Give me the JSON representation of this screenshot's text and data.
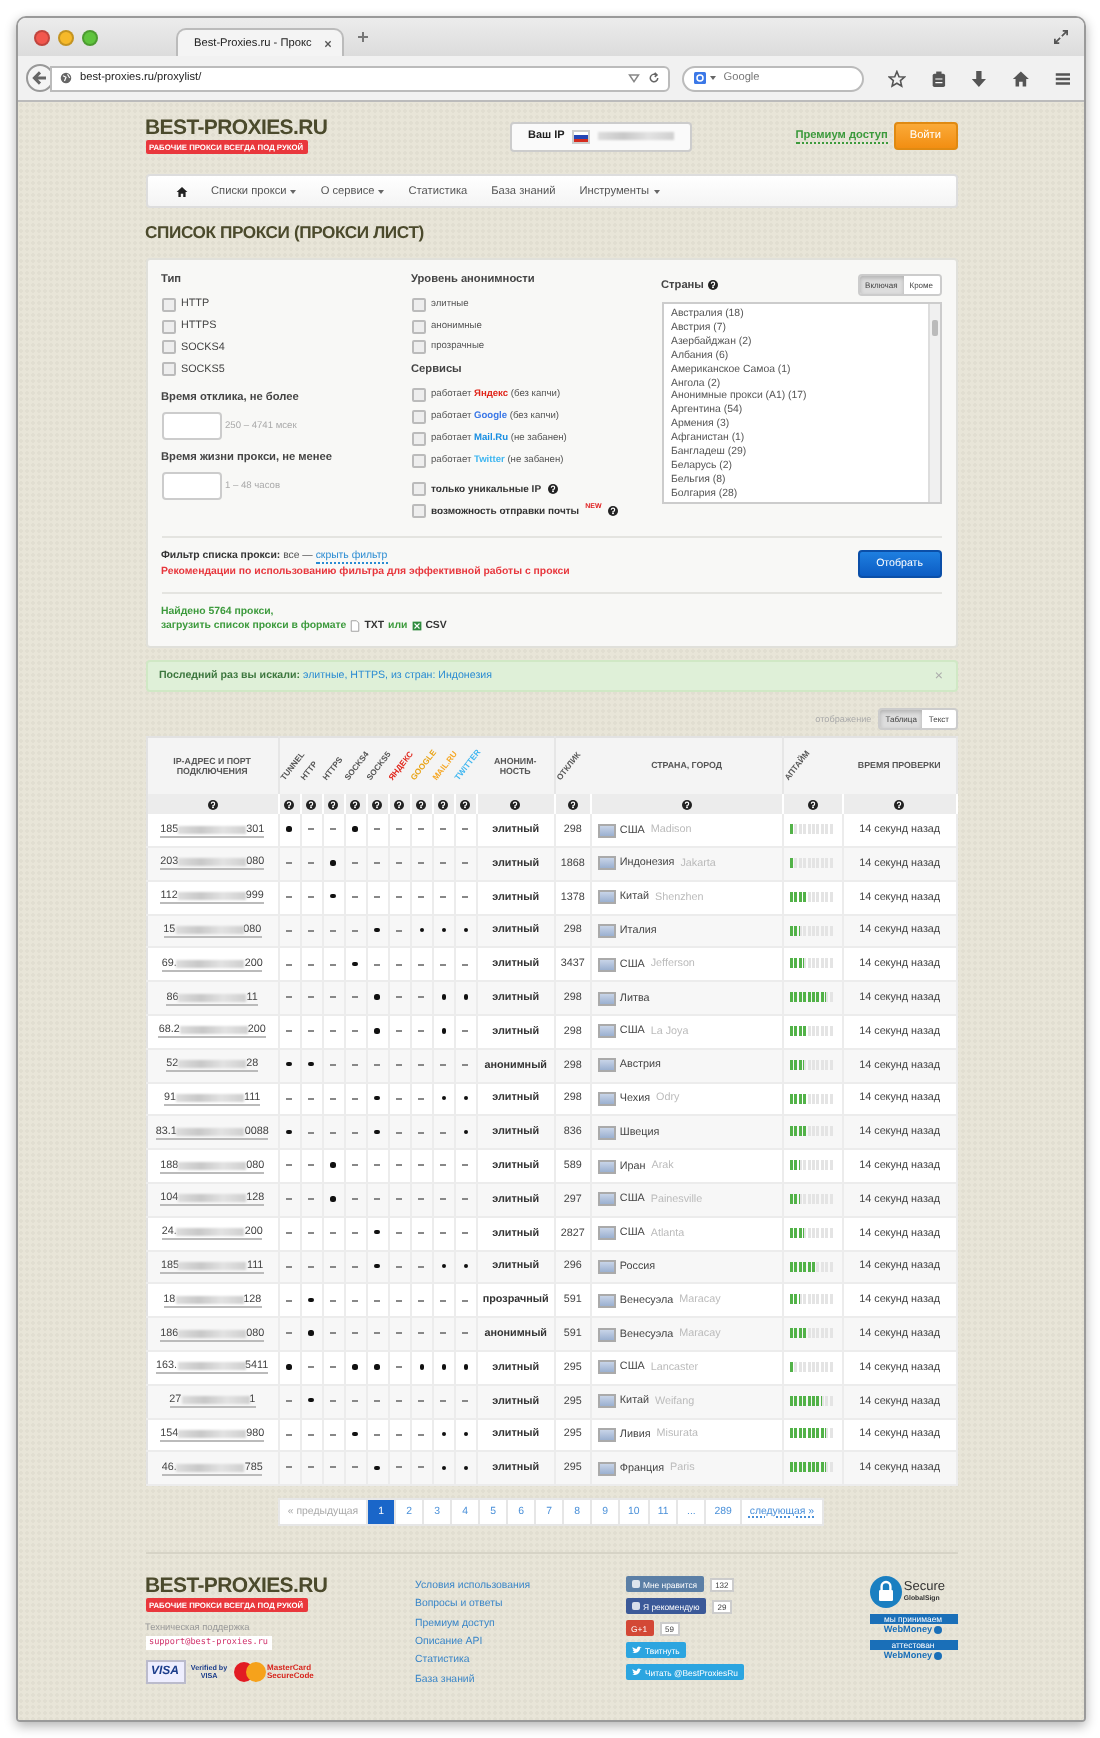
{
  "browser": {
    "tab_title": "Best-Proxies.ru - Прокс",
    "url": "best-proxies.ru/proxylist/",
    "search_placeholder": "Google"
  },
  "header": {
    "logo": "BEST-PROXIES.RU",
    "tagline": "РАБОЧИЕ ПРОКСИ ВСЕГДА ПОД РУКОЙ",
    "ip_label": "Ваш IP",
    "premium_link": "Премиум доступ",
    "login_button": "Войти"
  },
  "nav": [
    {
      "kind": "home"
    },
    {
      "kind": "dropdown",
      "label": "Списки прокси"
    },
    {
      "kind": "dropdown",
      "label": "О сервисе"
    },
    {
      "kind": "link",
      "label": "Статистика"
    },
    {
      "kind": "link",
      "label": "База знаний"
    },
    {
      "kind": "dropdown",
      "label": "Инструменты"
    }
  ],
  "page_title": "СПИСОК ПРОКСИ (ПРОКСИ ЛИСТ)",
  "filter": {
    "type": {
      "title": "Тип",
      "options": [
        {
          "label": "HTTP",
          "checked": false
        },
        {
          "label": "HTTPS",
          "checked": false
        },
        {
          "label": "SOCKS4",
          "checked": false
        },
        {
          "label": "SOCKS5",
          "checked": false
        }
      ]
    },
    "response_time": {
      "title": "Время отклика, не более",
      "hint": "250 – 4741 мсек"
    },
    "lifetime": {
      "title": "Время жизни прокси, не менее",
      "hint": "1 – 48 часов"
    },
    "anonymity": {
      "title": "Уровень анонимности",
      "options": [
        {
          "label": "элитные",
          "checked": false
        },
        {
          "label": "анонимные",
          "checked": false
        },
        {
          "label": "прозрачные",
          "checked": false
        }
      ]
    },
    "services": {
      "title": "Сервисы",
      "options": [
        {
          "prefix": "работает",
          "brand": "Яндекс",
          "suffix": "(без капчи)",
          "color": "#e0261b",
          "checked": false
        },
        {
          "prefix": "работает",
          "brand": "Google",
          "suffix": "(без капчи)",
          "color": "#3b78e7",
          "checked": false
        },
        {
          "prefix": "работает",
          "brand": "Mail.Ru",
          "suffix": "(не забанен)",
          "color": "#168de2",
          "checked": false
        },
        {
          "prefix": "работает",
          "brand": "Twitter",
          "suffix": "(не забанен)",
          "color": "#3fb6f0",
          "checked": false
        }
      ]
    },
    "extras": [
      {
        "label": "только уникальные IP",
        "checked": false
      },
      {
        "label": "возможность отправки почты",
        "checked": false,
        "badge": "NEW"
      }
    ],
    "countries": {
      "title": "Страны",
      "modes": [
        {
          "label": "Включая",
          "selected": true
        },
        {
          "label": "Кроме",
          "selected": false
        }
      ],
      "items": [
        "Австралия (18)",
        "Австрия (7)",
        "Азербайджан (2)",
        "Албания (6)",
        "Американское Самоа (1)",
        "Ангола (2)",
        "Анонимные прокси (A1) (17)",
        "Аргентина (54)",
        "Армения (3)",
        "Афганистан (1)",
        "Бангладеш (29)",
        "Беларусь (2)",
        "Бельгия (8)",
        "Болгария (28)"
      ]
    },
    "summary": "**Фильтр списка прокси:** все —",
    "summary_link": "скрыть фильтр",
    "recommendation": "Рекомендации по использованию фильтра для эффективной работы с прокси",
    "submit": "Отобрать",
    "found": "Найдено 5764 прокси,",
    "download_text": "загрузить список прокси в формате",
    "txt": "TXT",
    "or": "или",
    "csv": "CSV"
  },
  "last_search": {
    "label": "Последний раз вы искали:",
    "query": "элитные, HTTPS, из стран: Индонезия",
    "close": "×"
  },
  "display": {
    "label": "отображение",
    "modes": [
      {
        "label": "Таблица",
        "selected": true
      },
      {
        "label": "Текст",
        "selected": false
      }
    ]
  },
  "table": {
    "columns": [
      {
        "kind": "text",
        "label": "IP-АДРЕС И ПОРТ ПОДКЛЮЧЕНИЯ",
        "color": "#555555"
      },
      {
        "kind": "diagonal",
        "label": "TUNNEL",
        "color": "#555555"
      },
      {
        "kind": "diagonal",
        "label": "HTTP",
        "color": "#555555"
      },
      {
        "kind": "diagonal",
        "label": "HTTPS",
        "color": "#555555"
      },
      {
        "kind": "diagonal",
        "label": "SOCKS4",
        "color": "#555555"
      },
      {
        "kind": "diagonal",
        "label": "SOCKS5",
        "color": "#555555"
      },
      {
        "kind": "diagonal",
        "label": "ЯНДЕКС",
        "color": "#e0261b"
      },
      {
        "kind": "diagonal",
        "label": "GOOGLE",
        "color": "#e8a317"
      },
      {
        "kind": "diagonal",
        "label": "MAIL.RU",
        "color": "#f5a623"
      },
      {
        "kind": "diagonal",
        "label": "TWITTER",
        "color": "#3fb6f0"
      },
      {
        "kind": "text",
        "label": "АНОНИМ-НОСТЬ",
        "color": "#555555"
      },
      {
        "kind": "diagonal",
        "label": "ОТКЛИК",
        "color": "#555555"
      },
      {
        "kind": "text",
        "label": "СТРАНА, ГОРОД",
        "color": "#555555"
      },
      {
        "kind": "diagonal",
        "label": "АПТАЙМ",
        "color": "#555555"
      },
      {
        "kind": "text",
        "label": "ВРЕМЯ ПРОВЕРКИ",
        "color": "#555555"
      }
    ],
    "rows": [
      {
        "ip_start": "185",
        "ip_end": "301",
        "flags": [
          true,
          false,
          false,
          true,
          false,
          false,
          false,
          false,
          false
        ],
        "anonymity": "элитный",
        "response": "298",
        "country": "США",
        "city": "Madison",
        "level": 0.1,
        "checked": "14 секунд назад"
      },
      {
        "ip_start": "203",
        "ip_end": "080",
        "flags": [
          false,
          false,
          true,
          false,
          false,
          false,
          false,
          false,
          false
        ],
        "anonymity": "элитный",
        "response": "1868",
        "country": "Индонезия",
        "city": "Jakarta",
        "level": 0.1,
        "checked": "14 секунд назад"
      },
      {
        "ip_start": "112",
        "ip_end": "999",
        "flags": [
          false,
          false,
          true,
          false,
          false,
          false,
          false,
          false,
          false
        ],
        "anonymity": "элитный",
        "response": "1378",
        "country": "Китай",
        "city": "Shenzhen",
        "level": 0.4,
        "checked": "14 секунд назад"
      },
      {
        "ip_start": "15",
        "ip_end": "080",
        "flags": [
          false,
          false,
          false,
          false,
          true,
          false,
          true,
          true,
          true
        ],
        "anonymity": "элитный",
        "response": "298",
        "country": "Италия",
        "city": "",
        "level": 0.2,
        "checked": "14 секунд назад"
      },
      {
        "ip_start": "69.",
        "ip_end": "200",
        "flags": [
          false,
          false,
          false,
          true,
          false,
          false,
          false,
          false,
          false
        ],
        "anonymity": "элитный",
        "response": "3437",
        "country": "США",
        "city": "Jefferson",
        "level": 0.3,
        "checked": "14 секунд назад"
      },
      {
        "ip_start": "86",
        "ip_end": "11",
        "flags": [
          false,
          false,
          false,
          false,
          true,
          false,
          false,
          true,
          true
        ],
        "anonymity": "элитный",
        "response": "298",
        "country": "Литва",
        "city": "",
        "level": 0.8,
        "checked": "14 секунд назад"
      },
      {
        "ip_start": "68.2",
        "ip_end": "200",
        "flags": [
          false,
          false,
          false,
          false,
          true,
          false,
          false,
          true,
          false
        ],
        "anonymity": "элитный",
        "response": "298",
        "country": "США",
        "city": "La Joya",
        "level": 0.4,
        "checked": "14 секунд назад"
      },
      {
        "ip_start": "52",
        "ip_end": "28",
        "flags": [
          true,
          true,
          false,
          false,
          false,
          false,
          false,
          false,
          false
        ],
        "anonymity": "анонимный",
        "response": "298",
        "country": "Австрия",
        "city": "",
        "level": 0.3,
        "checked": "14 секунд назад"
      },
      {
        "ip_start": "91",
        "ip_end": "111",
        "flags": [
          false,
          false,
          false,
          false,
          true,
          false,
          false,
          true,
          true
        ],
        "anonymity": "элитный",
        "response": "298",
        "country": "Чехия",
        "city": "Odry",
        "level": 0.4,
        "checked": "14 секунд назад"
      },
      {
        "ip_start": "83.1",
        "ip_end": "0088",
        "flags": [
          true,
          false,
          false,
          false,
          true,
          false,
          false,
          false,
          true
        ],
        "anonymity": "элитный",
        "response": "836",
        "country": "Швеция",
        "city": "",
        "level": 0.4,
        "checked": "14 секунд назад"
      },
      {
        "ip_start": "188",
        "ip_end": "080",
        "flags": [
          false,
          false,
          true,
          false,
          false,
          false,
          false,
          false,
          false
        ],
        "anonymity": "элитный",
        "response": "589",
        "country": "Иран",
        "city": "Arak",
        "level": 0.2,
        "checked": "14 секунд назад"
      },
      {
        "ip_start": "104",
        "ip_end": "128",
        "flags": [
          false,
          false,
          true,
          false,
          false,
          false,
          false,
          false,
          false
        ],
        "anonymity": "элитный",
        "response": "297",
        "country": "США",
        "city": "Painesville",
        "level": 0.2,
        "checked": "14 секунд назад"
      },
      {
        "ip_start": "24.",
        "ip_end": "200",
        "flags": [
          false,
          false,
          false,
          false,
          true,
          false,
          false,
          false,
          false
        ],
        "anonymity": "элитный",
        "response": "2827",
        "country": "США",
        "city": "Atlanta",
        "level": 0.3,
        "checked": "14 секунд назад"
      },
      {
        "ip_start": "185",
        "ip_end": "111",
        "flags": [
          false,
          false,
          false,
          false,
          true,
          false,
          false,
          true,
          true
        ],
        "anonymity": "элитный",
        "response": "296",
        "country": "Россия",
        "city": "",
        "level": 0.6,
        "checked": "14 секунд назад"
      },
      {
        "ip_start": "18",
        "ip_end": "128",
        "flags": [
          false,
          true,
          false,
          false,
          false,
          false,
          false,
          false,
          false
        ],
        "anonymity": "прозрачный",
        "response": "591",
        "country": "Венесуэла",
        "city": "Maracay",
        "level": 0.2,
        "checked": "14 секунд назад"
      },
      {
        "ip_start": "186",
        "ip_end": "080",
        "flags": [
          false,
          true,
          false,
          false,
          false,
          false,
          false,
          false,
          false
        ],
        "anonymity": "анонимный",
        "response": "591",
        "country": "Венесуэла",
        "city": "Maracay",
        "level": 0.4,
        "checked": "14 секунд назад"
      },
      {
        "ip_start": "163.",
        "ip_end": "5411",
        "flags": [
          true,
          false,
          false,
          true,
          true,
          false,
          true,
          true,
          true
        ],
        "anonymity": "элитный",
        "response": "295",
        "country": "США",
        "city": "Lancaster",
        "level": 0.1,
        "checked": "14 секунд назад"
      },
      {
        "ip_start": "27",
        "ip_end": "1",
        "flags": [
          false,
          true,
          false,
          false,
          false,
          false,
          false,
          false,
          false
        ],
        "anonymity": "элитный",
        "response": "295",
        "country": "Китай",
        "city": "Weifang",
        "level": 0.7,
        "checked": "14 секунд назад"
      },
      {
        "ip_start": "154",
        "ip_end": "980",
        "flags": [
          false,
          false,
          false,
          true,
          false,
          false,
          false,
          true,
          true
        ],
        "anonymity": "элитный",
        "response": "295",
        "country": "Ливия",
        "city": "Misurata",
        "level": 0.8,
        "checked": "14 секунд назад"
      },
      {
        "ip_start": "46.",
        "ip_end": "785",
        "flags": [
          false,
          false,
          false,
          false,
          true,
          false,
          false,
          true,
          true
        ],
        "anonymity": "элитный",
        "response": "295",
        "country": "Франция",
        "city": "Paris",
        "level": 0.8,
        "checked": "14 секунд назад"
      }
    ]
  },
  "pagination": {
    "prev": "« предыдущая",
    "next": "следующая »",
    "pages": [
      {
        "label": "1",
        "selected": true
      },
      {
        "label": "2",
        "selected": false
      },
      {
        "label": "3",
        "selected": false
      },
      {
        "label": "4",
        "selected": false
      },
      {
        "label": "5",
        "selected": false
      },
      {
        "label": "6",
        "selected": false
      },
      {
        "label": "7",
        "selected": false
      },
      {
        "label": "8",
        "selected": false
      },
      {
        "label": "9",
        "selected": false
      },
      {
        "label": "10",
        "selected": false
      },
      {
        "label": "11",
        "selected": false
      },
      {
        "label": "...",
        "selected": false
      },
      {
        "label": "289",
        "selected": false
      }
    ]
  },
  "footer": {
    "logo": "BEST-PROXIES.RU",
    "tagline": "РАБОЧИЕ ПРОКСИ ВСЕГДА ПОД РУКОЙ",
    "support_label": "Техническая поддержка",
    "email": "support@best-proxies.ru",
    "payments": [
      "VISA",
      "Verified by VISA",
      "MasterCard SecureCode"
    ],
    "links": [
      "Условия использования",
      "Вопросы и ответы",
      "Премиум доступ",
      "Описание API",
      "Статистика",
      "База знаний"
    ],
    "social": [
      {
        "kind": "vk",
        "label": "Мне нравится",
        "count": "132"
      },
      {
        "kind": "facebook",
        "label": "Я рекомендую",
        "count": "29"
      },
      {
        "kind": "gplus",
        "label": "G+1",
        "count": "59"
      },
      {
        "kind": "twitter",
        "label": "Твитнуть"
      },
      {
        "kind": "twitter",
        "label": "Читать @BestProxiesRu"
      }
    ],
    "secure": {
      "title": "Secure",
      "issuer": "GlobalSign"
    },
    "webmoney": [
      {
        "caption": "мы принимаем",
        "brand": "WebMoney"
      },
      {
        "caption": "аттестован",
        "brand": "WebMoney"
      }
    ]
  }
}
